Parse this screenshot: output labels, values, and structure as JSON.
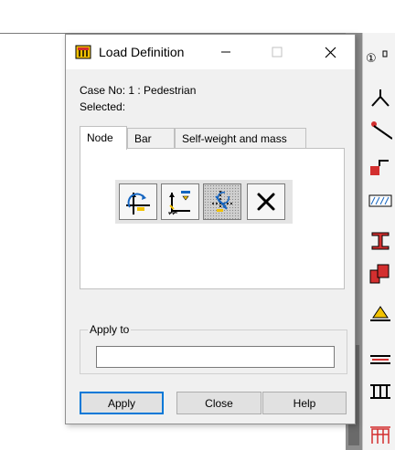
{
  "dialog": {
    "title": "Load Definition",
    "case_label": "Case No: 1 : Pedestrian",
    "selected_label": "Selected:",
    "tabs": [
      {
        "label": "Node",
        "active": true
      },
      {
        "label": "Bar",
        "active": false
      },
      {
        "label": "Self-weight and mass",
        "active": false
      }
    ],
    "tools": [
      {
        "icon": "nodal-force-icon",
        "pressed": false
      },
      {
        "icon": "imposed-displacement-icon",
        "pressed": false
      },
      {
        "icon": "in-plane-load-icon",
        "pressed": true
      },
      {
        "icon": "delete-load-icon",
        "pressed": false
      }
    ],
    "apply_to": {
      "label": "Apply to",
      "value": ""
    },
    "buttons": {
      "apply": "Apply",
      "close": "Close",
      "help": "Help"
    }
  },
  "background": {
    "corner_glyph": "①"
  },
  "colors": {
    "accent": "#0078d7",
    "icon_red": "#d32f2f",
    "icon_blue": "#1565c0",
    "icon_yellow": "#f2c200"
  }
}
